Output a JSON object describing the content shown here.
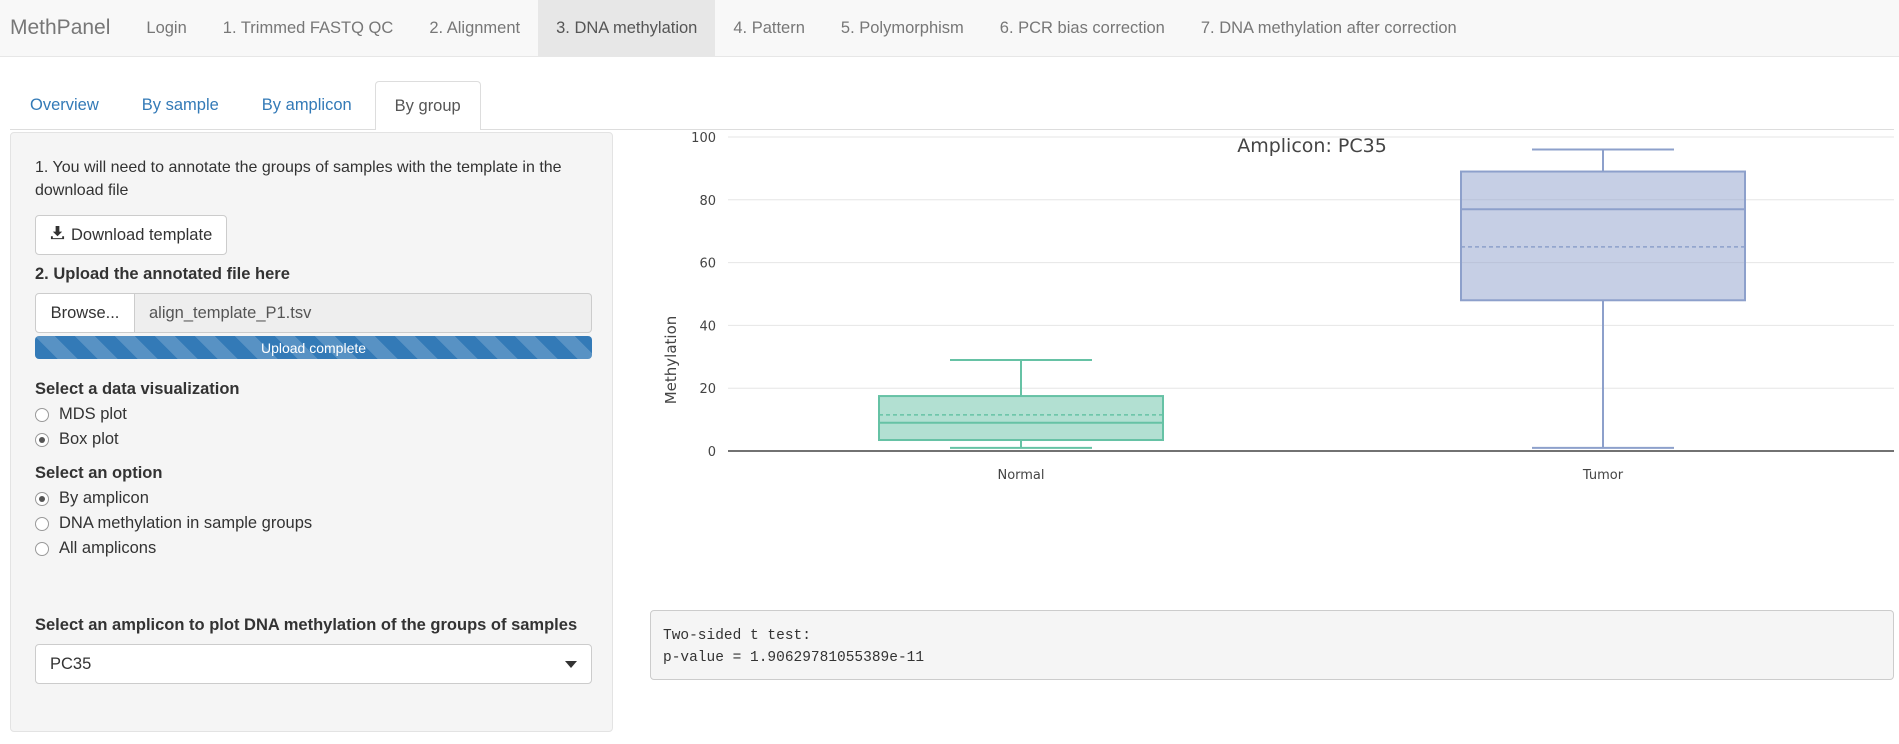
{
  "navbar": {
    "brand": "MethPanel",
    "items": [
      {
        "label": "Login",
        "active": false
      },
      {
        "label": "1. Trimmed FASTQ QC",
        "active": false
      },
      {
        "label": "2. Alignment",
        "active": false
      },
      {
        "label": "3. DNA methylation",
        "active": true
      },
      {
        "label": "4. Pattern",
        "active": false
      },
      {
        "label": "5. Polymorphism",
        "active": false
      },
      {
        "label": "6. PCR bias correction",
        "active": false
      },
      {
        "label": "7. DNA methylation after correction",
        "active": false
      }
    ]
  },
  "subtabs": [
    {
      "label": "Overview",
      "active": false
    },
    {
      "label": "By sample",
      "active": false
    },
    {
      "label": "By amplicon",
      "active": false
    },
    {
      "label": "By group",
      "active": true
    }
  ],
  "sidebar": {
    "step1_text": "1. You will need to annotate the groups of samples with the template in the download file",
    "download_button": "Download template",
    "download_icon": "download-icon",
    "step2_label": "2. Upload the annotated file here",
    "browse_button": "Browse...",
    "file_name": "align_template_P1.tsv",
    "progress_text": "Upload complete",
    "progress_fraction": 1.0,
    "viz_label": "Select a data visualization",
    "viz_options": [
      {
        "label": "MDS plot",
        "checked": false
      },
      {
        "label": "Box plot",
        "checked": true
      }
    ],
    "option_label": "Select an option",
    "options": [
      {
        "label": "By amplicon",
        "checked": true
      },
      {
        "label": "DNA methylation in sample groups",
        "checked": false
      },
      {
        "label": "All amplicons",
        "checked": false
      }
    ],
    "amplicon_label": "Select an amplicon to plot DNA methylation of the groups of samples",
    "amplicon_selected": "PC35"
  },
  "chart_data": {
    "type": "box",
    "title": "Amplicon: PC35",
    "xlabel": "",
    "ylabel": "Methylation",
    "ylim": [
      0,
      100
    ],
    "yticks": [
      0,
      20,
      40,
      60,
      80,
      100
    ],
    "grid": true,
    "categories": [
      "Normal",
      "Tumor"
    ],
    "boxes": [
      {
        "name": "Normal",
        "min": 1,
        "q1": 3.5,
        "median": 9,
        "mean": 11.5,
        "q3": 17.5,
        "max": 29,
        "color": "#66c2a5"
      },
      {
        "name": "Tumor",
        "min": 1,
        "q1": 48,
        "median": 77,
        "mean": 65,
        "q3": 89,
        "max": 96,
        "color": "#8da0cb"
      }
    ]
  },
  "result": {
    "line1": "Two-sided t test:",
    "line2": "p-value = 1.90629781055389e-11"
  }
}
